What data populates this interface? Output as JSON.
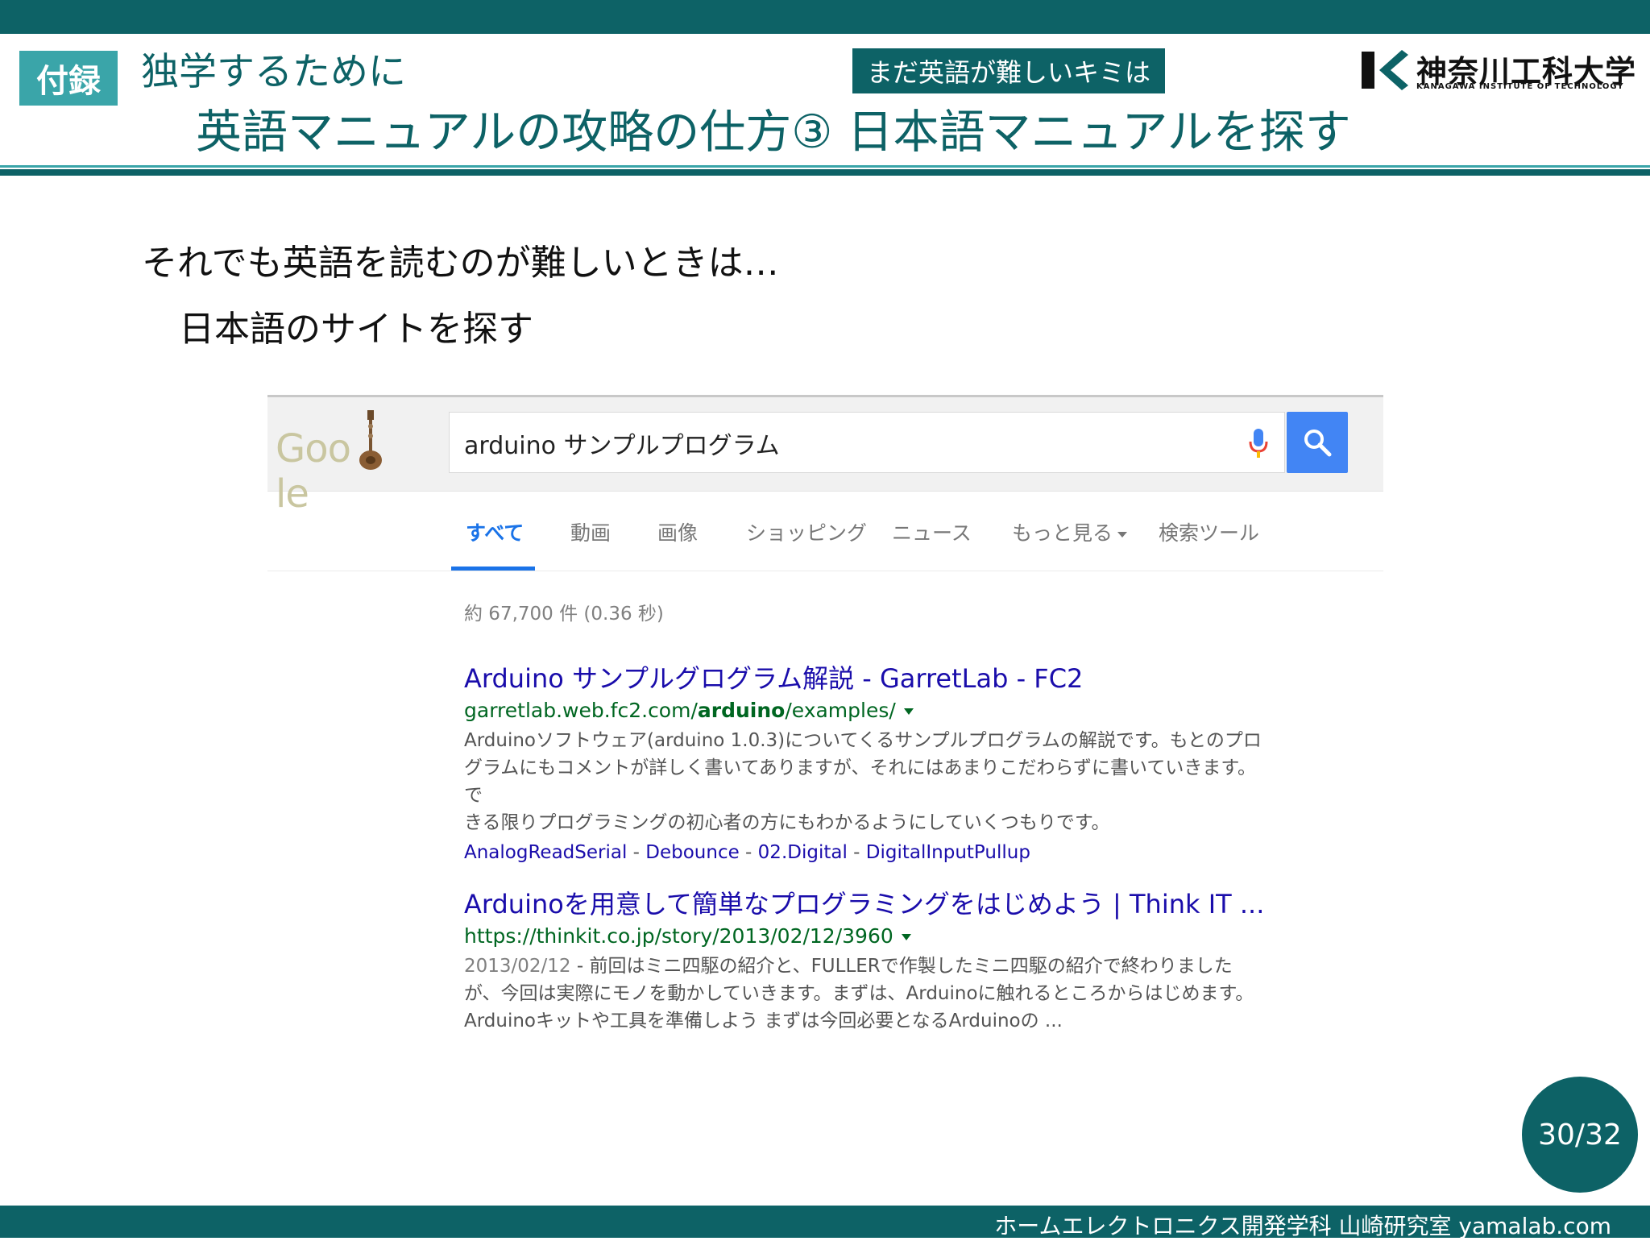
{
  "slide": {
    "appendix_badge": "付録",
    "subtitle": "独学するために",
    "tagline": "まだ英語が難しいキミは",
    "title": "英語マニュアルの攻略の仕方③ 日本語マニュアルを探す",
    "logo": {
      "name": "神奈川工科大学",
      "sub": "KANAGAWA INSTITUTE OF TECHNOLOGY"
    },
    "body_line1": "それでも英語を読むのが難しいときは…",
    "body_line2": "日本語のサイトを探す",
    "page_number": "30/32",
    "footer": "ホームエレクトロニクス開発学科 山崎研究室 yamalab.com"
  },
  "colors": {
    "brand_dark": "#0d6266",
    "brand_light": "#3aa5a9",
    "google_blue": "#4285f4",
    "link": "#1a0dab",
    "url_green": "#006621"
  },
  "google": {
    "logo_text": "Goo le",
    "query": "arduino サンプルプログラム",
    "tabs": [
      "すべて",
      "動画",
      "画像",
      "ショッピング",
      "ニュース",
      "もっと見る",
      "検索ツール"
    ],
    "active_tab": "すべて",
    "result_stats": "約 67,700 件 (0.36 秒)",
    "results": [
      {
        "title": "Arduino サンプルグログラム解説 - GarretLab - FC2",
        "url_prefix": "garretlab.web.fc2.com/",
        "url_bold": "arduino",
        "url_suffix": "/examples/",
        "snippet_lines": [
          "Arduinoソフトウェア(arduino 1.0.3)についてくるサンプルプログラムの解説です。もとのプロ",
          "グラムにもコメントが詳しく書いてありますが、それにはあまりこだわらずに書いていきます。で",
          "きる限りプログラミングの初心者の方にもわかるようにしていくつもりです。"
        ],
        "sitelinks": [
          "AnalogReadSerial",
          "Debounce",
          "02.Digital",
          "DigitalInputPullup"
        ]
      },
      {
        "title": "Arduinoを用意して簡単なプログラミングをはじめよう | Think IT ...",
        "url": "https://thinkit.co.jp/story/2013/02/12/3960",
        "date": "2013/02/12",
        "snippet_lines": [
          "前回はミニ四駆の紹介と、FULLERで作製したミニ四駆の紹介で終わりました",
          "が、今回は実際にモノを動かしていきます。まずは、Arduinoに触れるところからはじめます。",
          "Arduinoキットや工具を準備しよう まずは今回必要となるArduinoの ..."
        ]
      }
    ]
  }
}
